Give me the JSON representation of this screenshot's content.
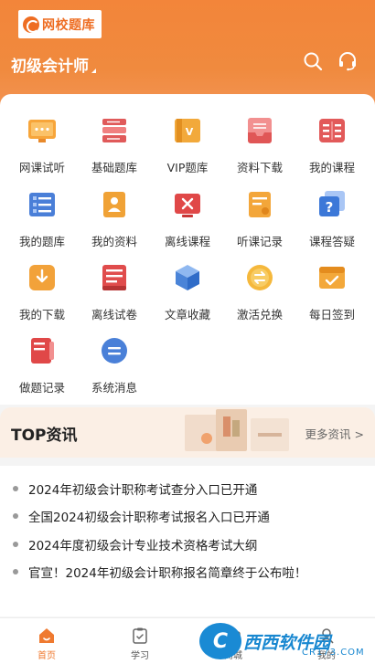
{
  "header": {
    "logo_text": "网校题库",
    "exam_title": "初级会计师"
  },
  "grid": [
    {
      "label": "网课试听"
    },
    {
      "label": "基础题库"
    },
    {
      "label": "VIP题库"
    },
    {
      "label": "资料下载"
    },
    {
      "label": "我的课程"
    },
    {
      "label": "我的题库"
    },
    {
      "label": "我的资料"
    },
    {
      "label": "离线课程"
    },
    {
      "label": "听课记录"
    },
    {
      "label": "课程答疑"
    },
    {
      "label": "我的下载"
    },
    {
      "label": "离线试卷"
    },
    {
      "label": "文章收藏"
    },
    {
      "label": "激活兑换"
    },
    {
      "label": "每日签到"
    },
    {
      "label": "做题记录"
    },
    {
      "label": "系统消息"
    }
  ],
  "news": {
    "title": "TOP资讯",
    "more": "更多资讯 >",
    "items": [
      "2024年初级会计职称考试查分入口已开通",
      "全国2024初级会计职称考试报名入口已开通",
      "2024年度初级会计专业技术资格考试大纲",
      "官宣！2024年初级会计职称报名简章终于公布啦！"
    ]
  },
  "nav": [
    {
      "label": "首页"
    },
    {
      "label": "学习"
    },
    {
      "label": "商城"
    },
    {
      "label": "我的"
    }
  ],
  "watermark": {
    "badge": "C",
    "main": "西西软件园",
    "sub": "CR173.COM"
  },
  "colors": {
    "accent": "#ef7a30",
    "header": "#f3853a"
  }
}
